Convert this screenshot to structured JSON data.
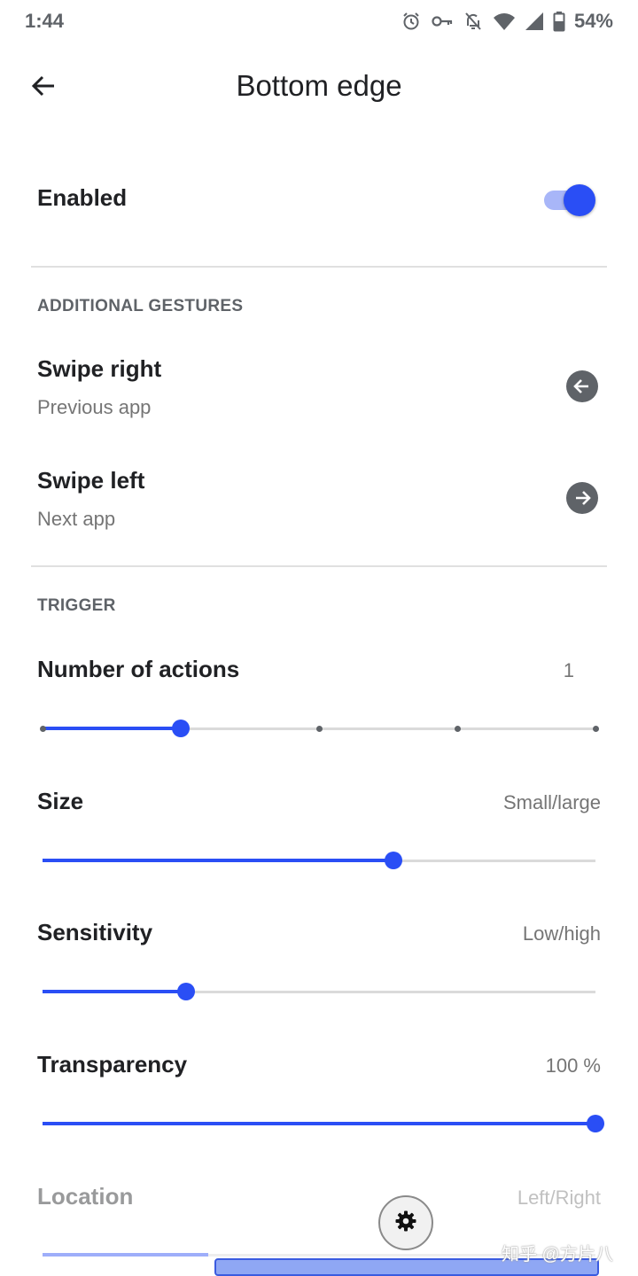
{
  "status_bar": {
    "time": "1:44",
    "battery": "54%",
    "icons": [
      "alarm-icon",
      "vpn-key-icon",
      "notifications-off-icon",
      "wifi-icon",
      "cell-signal-icon",
      "battery-icon"
    ]
  },
  "header": {
    "title": "Bottom edge",
    "back_icon": "arrow-back-icon"
  },
  "enabled": {
    "label": "Enabled",
    "checked": true
  },
  "additional_gestures": {
    "section_title": "ADDITIONAL GESTURES",
    "items": [
      {
        "title": "Swipe right",
        "subtitle": "Previous app",
        "icon": "arrow-left-circle-icon"
      },
      {
        "title": "Swipe left",
        "subtitle": "Next app",
        "icon": "arrow-right-circle-icon"
      }
    ]
  },
  "trigger": {
    "section_title": "TRIGGER",
    "number_of_actions": {
      "label": "Number of actions",
      "value": "1",
      "level": 0.25,
      "steps": 5
    },
    "size": {
      "label": "Size",
      "value": "Small/large",
      "level": 0.635
    },
    "sensitivity": {
      "label": "Sensitivity",
      "value": "Low/high",
      "level": 0.26
    },
    "transparency": {
      "label": "Transparency",
      "value": "100 %",
      "level": 1.0
    },
    "location": {
      "label": "Location",
      "value": "Left/Right",
      "level": 0.3
    }
  },
  "overlay": {
    "settings_icon": "gear-icon",
    "watermark": "知乎 @方片八"
  },
  "colors": {
    "accent": "#2a4ef5",
    "track": "#dadada",
    "text_primary": "#202124",
    "text_secondary": "#757575"
  }
}
